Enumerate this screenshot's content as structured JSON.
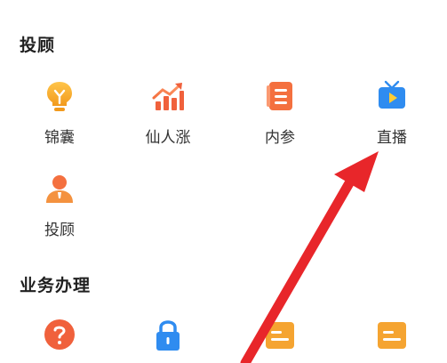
{
  "sections": [
    {
      "title": "投顾",
      "items": [
        {
          "label": "锦囊",
          "icon": "lightbulb-icon"
        },
        {
          "label": "仙人涨",
          "icon": "rising-chart-icon"
        },
        {
          "label": "内参",
          "icon": "document-list-icon"
        },
        {
          "label": "直播",
          "icon": "tv-play-icon"
        },
        {
          "label": "投顾",
          "icon": "advisor-person-icon"
        }
      ]
    },
    {
      "title": "业务办理",
      "items": [
        {
          "icon": "help-question-icon"
        },
        {
          "icon": "lock-icon"
        },
        {
          "icon": "card-icon"
        },
        {
          "icon": "card-icon"
        }
      ]
    }
  ],
  "colors": {
    "orange": "#f5a431",
    "red": "#f0613c",
    "blue": "#2f8cf0",
    "annotation_arrow": "#e8262a"
  }
}
